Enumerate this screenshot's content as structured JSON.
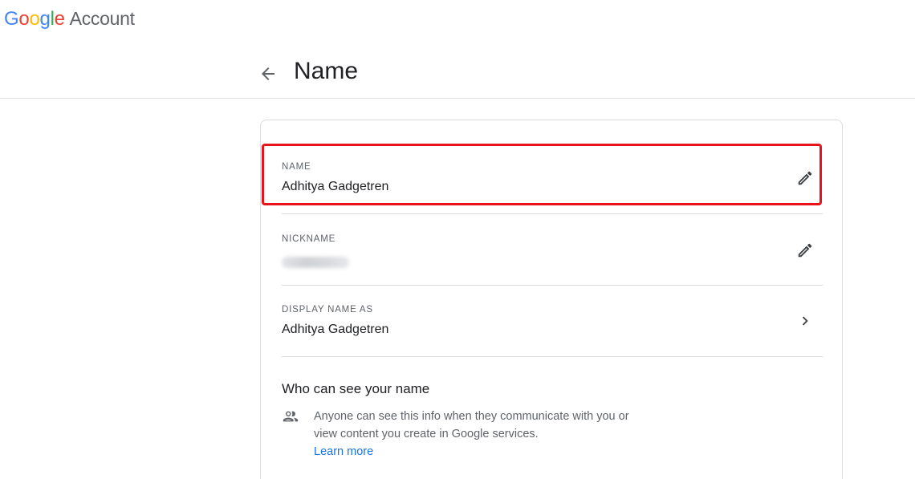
{
  "header": {
    "logo_letters": [
      {
        "char": "G",
        "color": "#4285F4"
      },
      {
        "char": "o",
        "color": "#EA4335"
      },
      {
        "char": "o",
        "color": "#FBBC05"
      },
      {
        "char": "g",
        "color": "#4285F4"
      },
      {
        "char": "l",
        "color": "#34A853"
      },
      {
        "char": "e",
        "color": "#EA4335"
      }
    ],
    "logo_suffix": "Account"
  },
  "page": {
    "title": "Name",
    "back_icon": "arrow-left-icon"
  },
  "card": {
    "name_row": {
      "label": "NAME",
      "value": "Adhitya Gadgetren",
      "icon": "pencil-icon",
      "highlight_color": "#e8141b"
    },
    "nickname_row": {
      "label": "NICKNAME",
      "icon": "pencil-icon"
    },
    "display_row": {
      "label": "DISPLAY NAME AS",
      "value": "Adhitya Gadgetren",
      "icon": "chevron-right-icon"
    },
    "visibility": {
      "title": "Who can see your name",
      "icon": "people-icon",
      "description": "Anyone can see this info when they communicate with you or view content you create in Google services.",
      "link_label": "Learn more"
    }
  },
  "colors": {
    "text_primary": "#202124",
    "text_secondary": "#5f6368",
    "divider": "#dadce0",
    "link": "#1a73e8"
  }
}
